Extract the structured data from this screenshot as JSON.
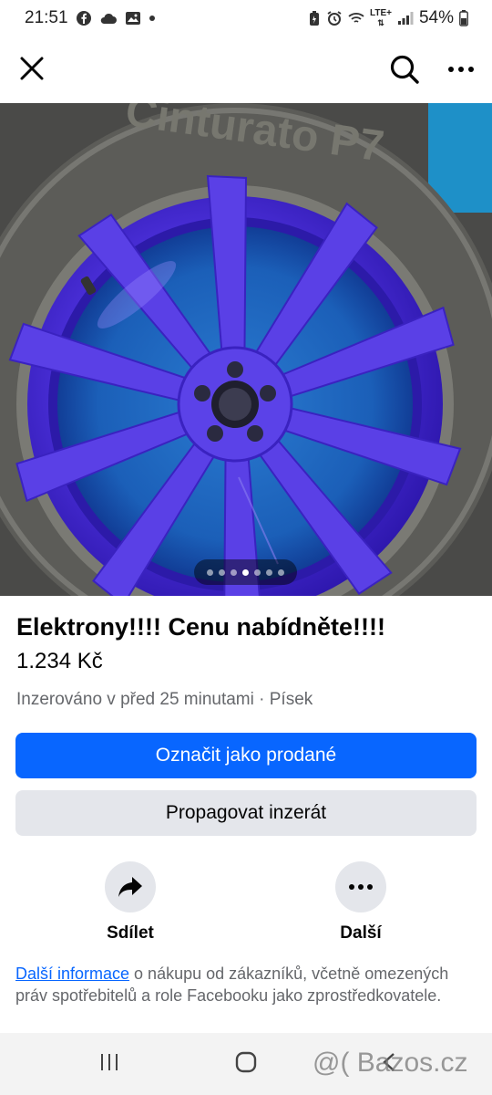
{
  "status_bar": {
    "time": "21:51",
    "left_icons": [
      "facebook-icon",
      "cloud-icon",
      "image-icon",
      "dot-icon"
    ],
    "right_icons": [
      "battery-saver-icon",
      "alarm-icon",
      "wifi-icon",
      "lte-icon",
      "signal-icon",
      "battery-icon"
    ],
    "network": "LTE+",
    "battery": "54%"
  },
  "top_bar": {
    "icons": [
      "close-icon",
      "search-icon",
      "more-icon"
    ]
  },
  "photo": {
    "subject_icon": "wheel-photo",
    "carousel_count": 7,
    "carousel_active_index": 3
  },
  "listing": {
    "title": "Elektrony!!!! Cenu nabídněte!!!!",
    "price": "1.234 Kč",
    "meta": "Inzerováno v před 25 minutami · Písek"
  },
  "buttons": {
    "mark_sold": "Označit jako prodané",
    "promote": "Propagovat inzerát"
  },
  "actions": {
    "share_label": "Sdílet",
    "more_label": "Další"
  },
  "info": {
    "link": "Další informace",
    "text": " o nákupu od zákazníků, včetně omezených práv spotřebitelů a role Facebooku jako zprostředkovatele."
  },
  "nav_bar": {
    "icons": [
      "recent-apps-icon",
      "home-icon",
      "back-icon"
    ]
  },
  "watermark": "@( Bazos.cz",
  "colors": {
    "primary": "#0866ff",
    "secondary_bg": "#e4e6eb",
    "muted_text": "#65676b",
    "wheel": "#4b2bd6"
  }
}
